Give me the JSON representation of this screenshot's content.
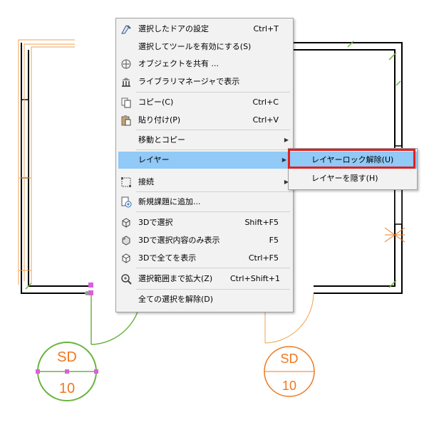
{
  "context_menu": {
    "items": [
      {
        "label": "選択したドアの設定",
        "shortcut": "Ctrl+T",
        "icon": "door-settings-icon"
      },
      {
        "label": "選択してツールを有効にする(S)",
        "shortcut": "",
        "icon": ""
      },
      {
        "label": "オブジェクトを共有 ...",
        "shortcut": "",
        "icon": "share-object-icon"
      },
      {
        "label": "ライブラリマネージャで表示",
        "shortcut": "",
        "icon": "library-icon"
      },
      {
        "label": "コピー(C)",
        "shortcut": "Ctrl+C",
        "icon": "copy-icon"
      },
      {
        "label": "貼り付け(P)",
        "shortcut": "Ctrl+V",
        "icon": "paste-icon"
      },
      {
        "label": "移動とコピー",
        "shortcut": "",
        "icon": ""
      },
      {
        "label": "レイヤー",
        "shortcut": "",
        "icon": ""
      },
      {
        "label": "接続",
        "shortcut": "",
        "icon": "connect-icon"
      },
      {
        "label": "新規課題に追加...",
        "shortcut": "",
        "icon": "new-issue-icon"
      },
      {
        "label": "3Dで選択",
        "shortcut": "Shift+F5",
        "icon": "3d-select-icon"
      },
      {
        "label": "3Dで選択内容のみ表示",
        "shortcut": "F5",
        "icon": "3d-show-selection-icon"
      },
      {
        "label": "3Dで全てを表示",
        "shortcut": "Ctrl+F5",
        "icon": "3d-show-all-icon"
      },
      {
        "label": "選択範囲まで拡大(Z)",
        "shortcut": "Ctrl+Shift+1",
        "icon": "zoom-selection-icon"
      },
      {
        "label": "全ての選択を解除(D)",
        "shortcut": "",
        "icon": ""
      }
    ]
  },
  "submenu": {
    "items": [
      {
        "label": "レイヤーロック解除(U)"
      },
      {
        "label": "レイヤーを隠す(H)"
      }
    ]
  },
  "drawing": {
    "door_tag_left": {
      "top": "SD",
      "bottom": "10"
    },
    "door_tag_right": {
      "top": "SD",
      "bottom": "10"
    }
  },
  "colors": {
    "tag_orange": "#f07820",
    "tag_green": "#6cb33f",
    "selection_pink": "#d860d8",
    "menu_highlight": "#91c9f7",
    "red_frame": "#e02020"
  }
}
